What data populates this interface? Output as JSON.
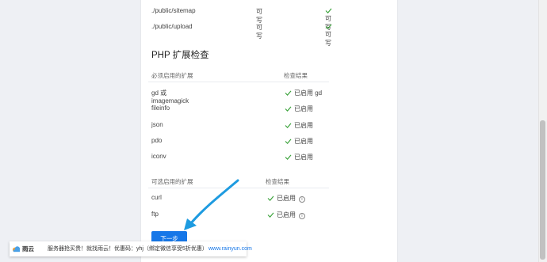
{
  "permissions": [
    {
      "path": "./public/sitemap",
      "required": "可写",
      "current": "可写"
    },
    {
      "path": "./public/upload",
      "required": "可写",
      "current": "可写"
    }
  ],
  "php_section": {
    "title": "PHP 扩展检查",
    "required": {
      "header_name": "必须启用的扩展",
      "header_result": "检查结果",
      "rows": [
        {
          "name": "gd 或 imagemagick",
          "result": "已启用 gd"
        },
        {
          "name": "fileinfo",
          "result": "已启用"
        },
        {
          "name": "json",
          "result": "已启用"
        },
        {
          "name": "pdo",
          "result": "已启用"
        },
        {
          "name": "iconv",
          "result": "已启用"
        }
      ]
    },
    "optional": {
      "header_name": "可选启用的扩展",
      "header_result": "检查结果",
      "rows": [
        {
          "name": "curl",
          "result": "已启用"
        },
        {
          "name": "ftp",
          "result": "已启用"
        }
      ]
    }
  },
  "next_button": "下一步",
  "info_glyph": "i",
  "watermark": {
    "brand": "雨云",
    "text": "服务器抢买贵！就找雨云！优惠码：yhj（绑定微信享受5折优惠）",
    "url": "www.rainyun.com"
  },
  "colors": {
    "check": "#3aa23a",
    "button": "#1677e8",
    "arrow": "#1e9be0"
  }
}
